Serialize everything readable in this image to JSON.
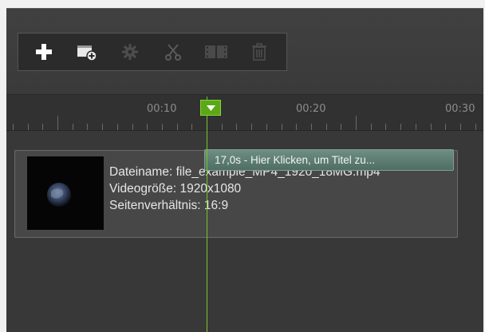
{
  "toolbar": {
    "buttons": [
      {
        "name": "add-icon",
        "enabled": true
      },
      {
        "name": "add-media-icon",
        "enabled": true
      },
      {
        "name": "settings-icon",
        "enabled": false
      },
      {
        "name": "cut-icon",
        "enabled": false
      },
      {
        "name": "film-icon",
        "enabled": false
      },
      {
        "name": "trash-icon",
        "enabled": false
      }
    ]
  },
  "ruler": {
    "labels": [
      "00:10",
      "00:20",
      "00:30"
    ]
  },
  "clip": {
    "filename": "Dateiname: file_example_MP4_1920_18MG.mp4",
    "size": "Videogröße: 1920x1080",
    "ratio": "Seitenverhältnis: 16:9"
  },
  "title_clip": {
    "label": "17,0s - Hier Klicken, um Titel zu..."
  },
  "colors": {
    "accent": "#5aa816",
    "background": "#383838",
    "title_clip": "#5f7f73"
  }
}
